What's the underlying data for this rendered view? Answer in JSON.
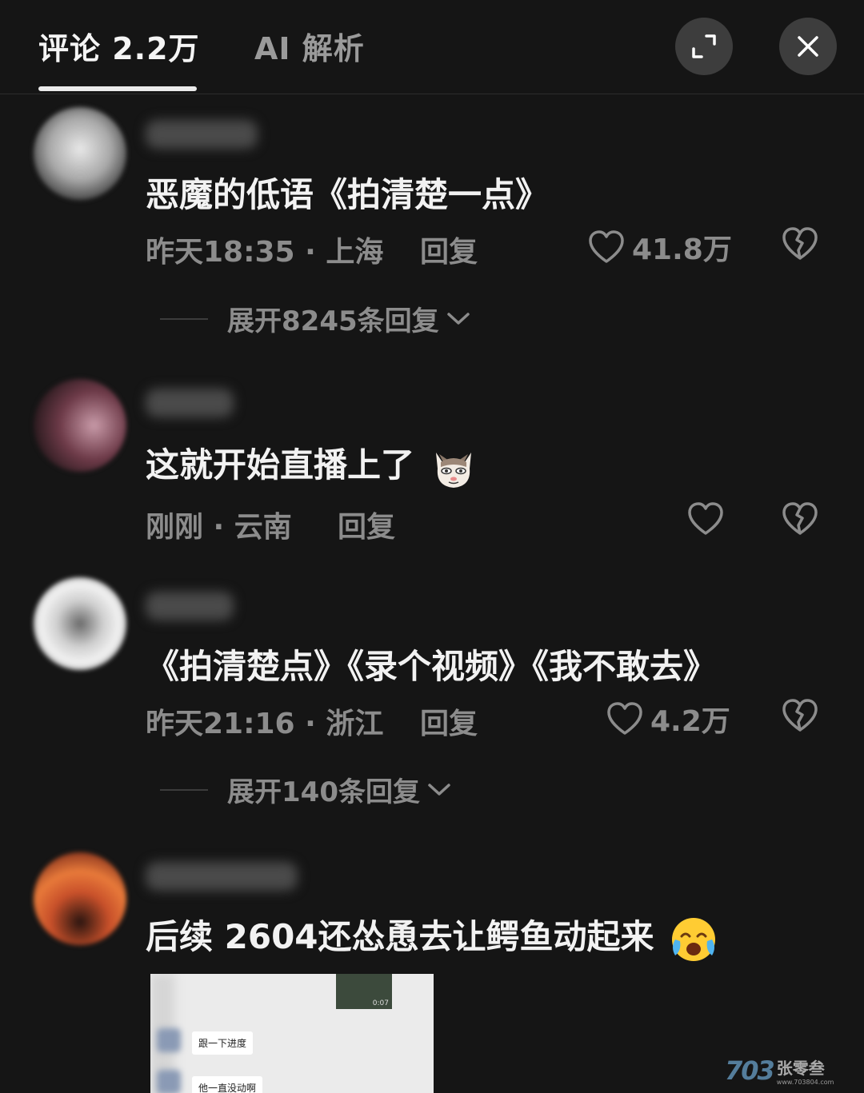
{
  "header": {
    "tab_comments": "评论 2.2万",
    "tab_ai": "AI 解析",
    "expand_icon": "expand-icon",
    "close_icon": "close-icon"
  },
  "comments": [
    {
      "text": "恶魔的低语《拍清楚一点》",
      "time_location": "昨天18:35 · 上海",
      "reply": "回复",
      "likes": "41.8万",
      "expand_replies": "展开8245条回复"
    },
    {
      "text": "这就开始直播上了",
      "emoji": "cat-smug-emoji",
      "time_location": "刚刚 · 云南",
      "reply": "回复",
      "likes": ""
    },
    {
      "text": "《拍清楚点》《录个视频》《我不敢去》",
      "time_location": "昨天21:16 · 浙江",
      "reply": "回复",
      "likes": "4.2万",
      "expand_replies": "展开140条回复"
    },
    {
      "text": "后续 2604还怂恿去让鳄鱼动起来",
      "emoji": "crying-laughing-emoji",
      "attachment": {
        "video_duration": "0:07",
        "bubble_1": "跟一下进度",
        "bubble_2": "他一直没动啊"
      }
    }
  ],
  "watermark": {
    "logo": "703",
    "name": "张零叁",
    "url": "www.703804.com"
  },
  "colors": {
    "background": "#151515",
    "text_primary": "#f2f2f2",
    "text_secondary": "#8c8c8c"
  }
}
